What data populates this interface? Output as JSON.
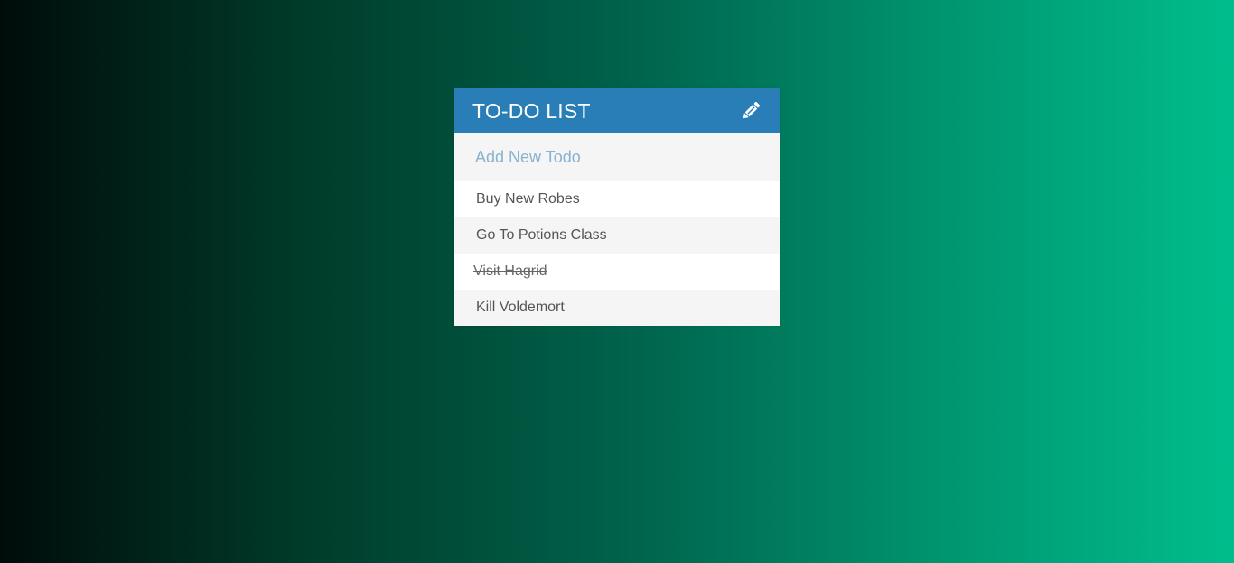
{
  "header": {
    "title": "TO-DO LIST",
    "icon": "pencil-icon"
  },
  "new_todo": {
    "placeholder": "Add New Todo",
    "value": ""
  },
  "todos": [
    {
      "text": "Buy New Robes",
      "completed": false
    },
    {
      "text": "Go To Potions Class",
      "completed": false
    },
    {
      "text": "Visit Hagrid",
      "completed": true
    },
    {
      "text": "Kill Voldemort",
      "completed": false
    }
  ],
  "colors": {
    "header_bg": "#2a7eb8",
    "placeholder": "#87b3d0",
    "gradient_start": "#000c0a",
    "gradient_end": "#00bd8c"
  }
}
